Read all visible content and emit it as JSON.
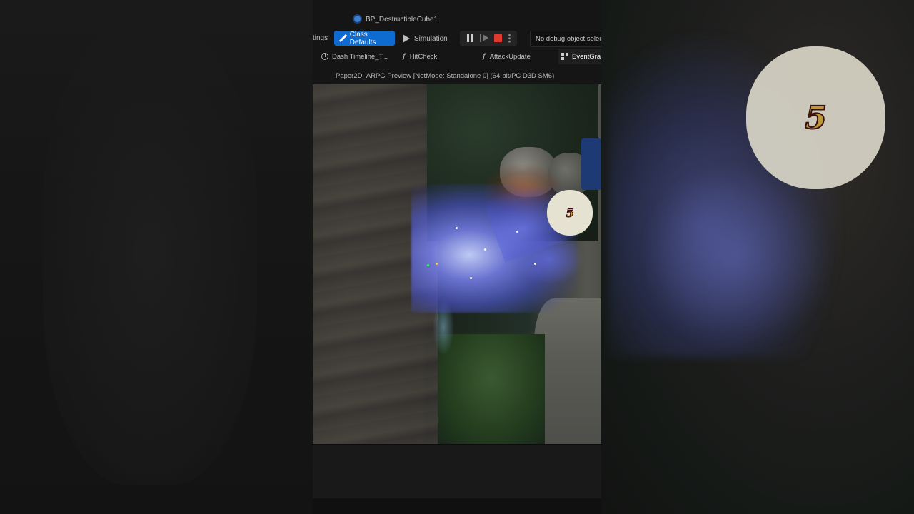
{
  "window": {
    "title": "BP_DestructibleCube1"
  },
  "toolbar": {
    "settings_label": "tings",
    "class_defaults_label": "Class Defaults",
    "simulation_label": "Simulation",
    "debug_object_label": "No debug object selecte"
  },
  "tabs": [
    {
      "label": "Dash Timeline_T...",
      "icon": "clock-icon"
    },
    {
      "label": "HitCheck",
      "icon": "function-icon"
    },
    {
      "label": "AttackUpdate",
      "icon": "function-icon"
    },
    {
      "label": "EventGrap",
      "icon": "event-graph-icon"
    }
  ],
  "viewport": {
    "header": "Paper2D_ARPG Preview [NetMode: Standalone 0]  (64-bit/PC D3D SM6)",
    "damage_number": "5"
  },
  "background": {
    "damage_number": "5"
  },
  "colors": {
    "accent": "#0e6cd1",
    "stop": "#e03a2e",
    "panel": "#151515"
  }
}
